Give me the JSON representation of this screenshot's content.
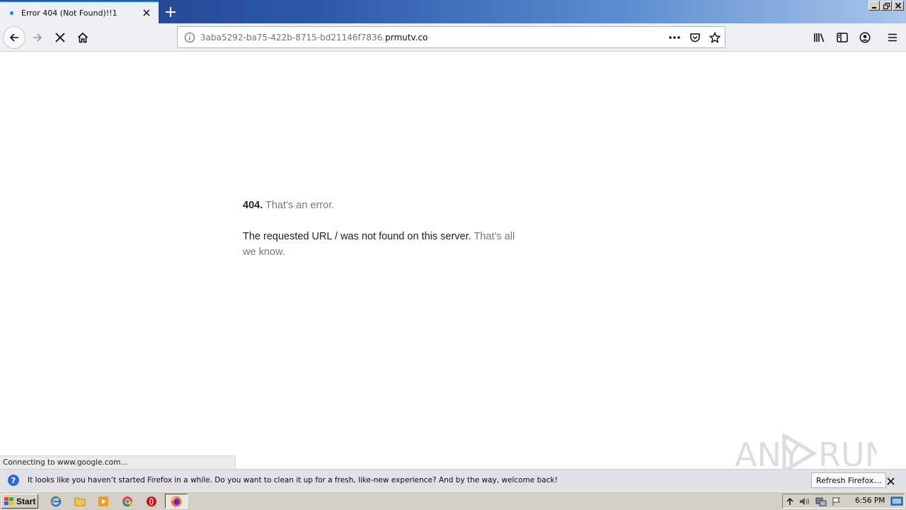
{
  "tab": {
    "title": "Error 404 (Not Found)!!1",
    "close_icon": "close-icon"
  },
  "toolbar": {
    "url_prefix": "3aba5292-ba75-422b-8715-bd21146f7836.",
    "url_host": "prmutv.co"
  },
  "page": {
    "code": "404.",
    "error_text": "That’s an error.",
    "message": "The requested URL / was not found on this server.",
    "suffix": "That’s all we know."
  },
  "status_bar": {
    "text": "Connecting to www.google.com..."
  },
  "notification": {
    "message": "It looks like you haven’t started Firefox in a while. Do you want to clean it up for a fresh, like-new experience? And by the way, welcome back!",
    "button_label": "Refresh Firefox…"
  },
  "taskbar": {
    "start_label": "Start",
    "clock": "6:56 PM"
  },
  "colors": {
    "accent": "#0a84ff",
    "title_gradient_start": "#1f3f86",
    "toolbar_bg": "#f0f0f4"
  }
}
